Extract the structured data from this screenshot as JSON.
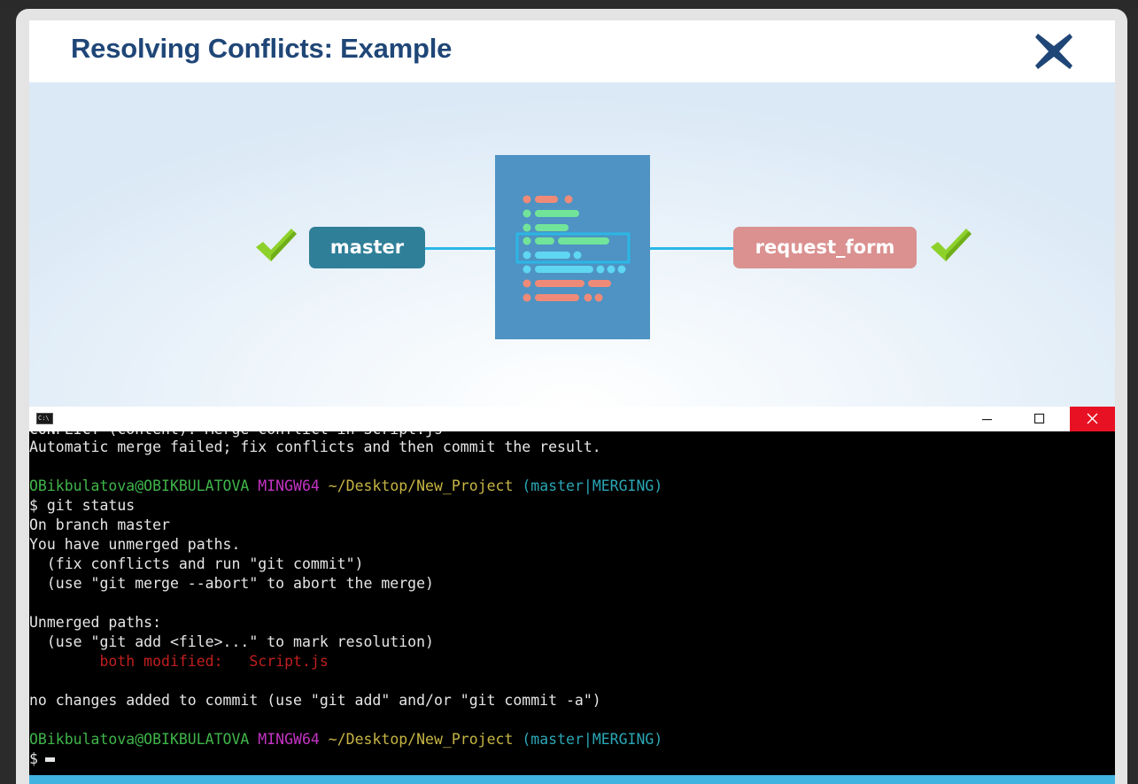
{
  "slide": {
    "title": "Resolving Conflicts: Example"
  },
  "diagram": {
    "left_branch": "master",
    "right_branch": "request_form",
    "colors": {
      "master": "#2f7f98",
      "request_form": "#da9190",
      "check": "#8ed12b",
      "document": "#4e93c3",
      "connector": "#2bb7e6"
    }
  },
  "terminal": {
    "icon_label": "C:\\",
    "partial_line": "CONFLICT (content): Merge conflict in Script.js",
    "lines": {
      "l1": "Automatic merge failed; fix conflicts and then commit the result.",
      "p1_user": "OBikbulatova@OBIKBULATOVA",
      "p1_sys": "MINGW64",
      "p1_path": "~/Desktop/New_Project",
      "p1_branch": "(master|MERGING)",
      "l3": "$ git status",
      "l4": "On branch master",
      "l5": "You have unmerged paths.",
      "l6": "  (fix conflicts and run \"git commit\")",
      "l7": "  (use \"git merge --abort\" to abort the merge)",
      "l8": "Unmerged paths:",
      "l9": "  (use \"git add <file>...\" to mark resolution)",
      "l10": "        both modified:   Script.js",
      "l11": "no changes added to commit (use \"git add\" and/or \"git commit -a\")",
      "p2_user": "OBikbulatova@OBIKBULATOVA",
      "p2_sys": "MINGW64",
      "p2_path": "~/Desktop/New_Project",
      "p2_branch": "(master|MERGING)",
      "l13": "$"
    }
  }
}
